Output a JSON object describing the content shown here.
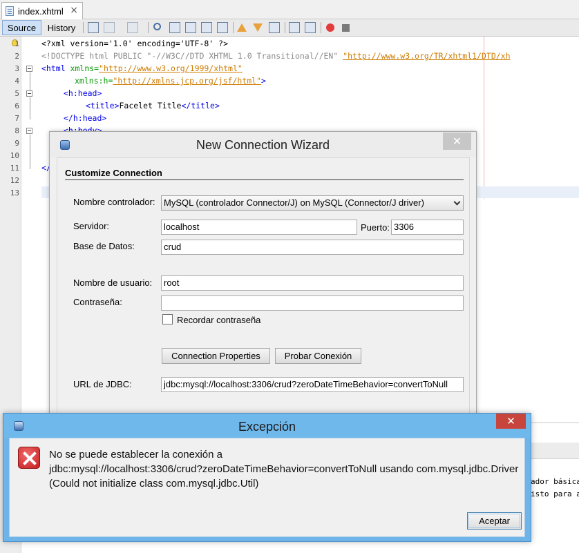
{
  "editor": {
    "file_tab": "index.xhtml",
    "toolbar": {
      "source_label": "Source",
      "history_label": "History"
    },
    "line_numbers": [
      "1",
      "2",
      "3",
      "4",
      "5",
      "6",
      "7",
      "8",
      "9",
      "10",
      "11",
      "12",
      "13"
    ],
    "code": {
      "l1": "<?xml version='1.0' encoding='UTF-8' ?>",
      "l2": "<!DOCTYPE html PUBLIC \"-//W3C//DTD XHTML 1.0 Transitional//EN\" ",
      "l2_url": "\"http://www.w3.org/TR/xhtml1/DTD/xh",
      "l3_tag": "<html ",
      "l3_attr": "xmlns=",
      "l3_val": "\"http://www.w3.org/1999/xhtml\"",
      "l4_attr": "xmlns:h=",
      "l4_val": "\"http://xmlns.jcp.org/jsf/html\"",
      "l4_tag": ">",
      "l5": "<h:head>",
      "l6_open": "<title>",
      "l6_text": "Facelet Title",
      "l6_close": "</title>",
      "l7": "</h:head>",
      "l8": "<h:body>",
      "l11": "</"
    },
    "output_snippets": [
      "ador básica",
      "isto para a"
    ]
  },
  "wizard": {
    "title": "New Connection Wizard",
    "close_glyph": "✕",
    "section": "Customize Connection",
    "driver_label": "Nombre controlador:",
    "driver_value": "MySQL (controlador Connector/J) on MySQL (Connector/J driver)",
    "server_label": "Servidor:",
    "server_value": "localhost",
    "port_label": "Puerto:",
    "port_value": "3306",
    "database_label": "Base de Datos:",
    "database_value": "crud",
    "user_label": "Nombre de usuario:",
    "user_value": "root",
    "password_label": "Contraseña:",
    "password_value": "",
    "remember_label": "Recordar contraseña",
    "remember_checked": false,
    "connection_properties_button": "Connection Properties",
    "test_connection_button": "Probar Conexión",
    "jdbc_label": "URL de JDBC:",
    "jdbc_value": "jdbc:mysql://localhost:3306/crud?zeroDateTimeBehavior=convertToNull"
  },
  "exception": {
    "title": "Excepción",
    "close_glyph": "✕",
    "message_line1": "No se puede establecer la conexión a",
    "message_line2": "jdbc:mysql://localhost:3306/crud?zeroDateTimeBehavior=convertToNull usando com.mysql.jdbc.Driver",
    "message_line3": "(Could not initialize class com.mysql.jdbc.Util)",
    "ok_button": "Aceptar",
    "colors": {
      "titlebar": "#6fb8ec",
      "close": "#c7453c"
    }
  }
}
